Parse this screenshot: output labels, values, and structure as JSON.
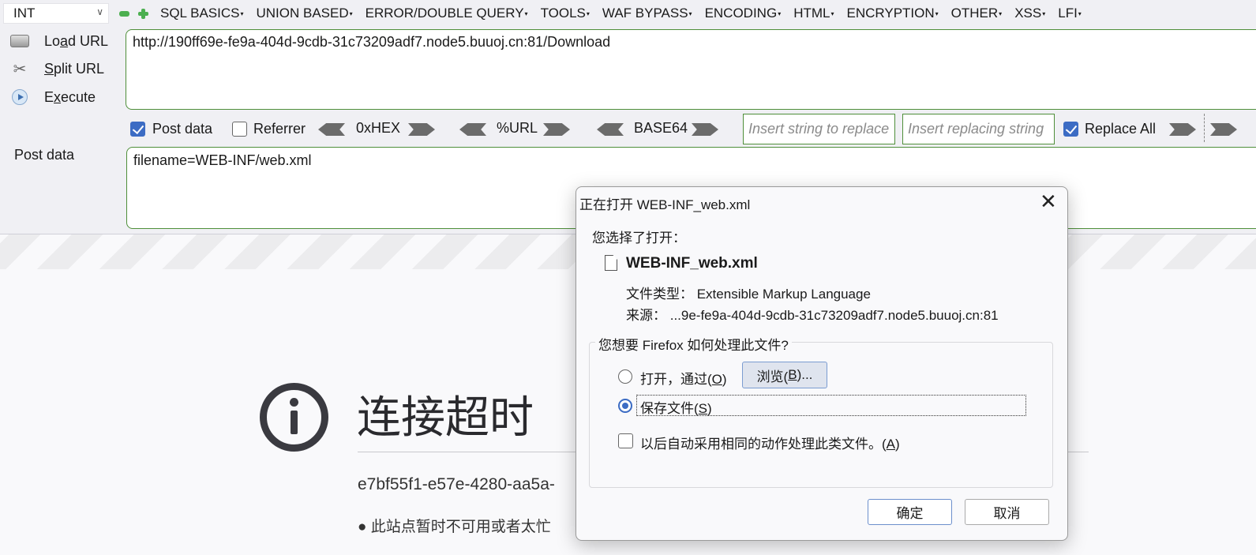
{
  "hackbar": {
    "type_select": "INT",
    "menu": [
      "SQL BASICS",
      "UNION BASED",
      "ERROR/DOUBLE QUERY",
      "TOOLS",
      "WAF BYPASS",
      "ENCODING",
      "HTML",
      "ENCRYPTION",
      "OTHER",
      "XSS",
      "LFI"
    ],
    "load_url": {
      "pre": "Lo",
      "key": "a",
      "post": "d URL"
    },
    "split_url": {
      "pre": "",
      "key": "S",
      "post": "plit URL"
    },
    "execute": {
      "pre": "E",
      "key": "x",
      "post": "ecute"
    },
    "url": "http://190ff69e-fe9a-404d-9cdb-31c73209adf7.node5.buuoj.cn:81/Download",
    "post_data_checkbox": "Post data",
    "post_data_checked": true,
    "referrer_checkbox": "Referrer",
    "referrer_checked": false,
    "hex_label": "0xHEX",
    "url_label": "%URL",
    "base64_label": "BASE64",
    "replace_placeholder": "Insert string to replace",
    "replacing_placeholder": "Insert replacing string",
    "replace_all_label": "Replace All",
    "replace_all_checked": true,
    "post_label": "Post data",
    "post_body": "filename=WEB-INF/web.xml"
  },
  "error_page": {
    "title": "连接超时",
    "id_text": "e7bf55f1-e57e-4280-aa5a-",
    "bullet": "此站点暂时不可用或者太忙"
  },
  "dialog": {
    "title": "正在打开 WEB-INF_web.xml",
    "chose_label": "您选择了打开：",
    "file_name": "WEB-INF_web.xml",
    "file_type": "文件类型：  Extensible Markup Language",
    "source": "来源：  ...9e-fe9a-404d-9cdb-31c73209adf7.node5.buuoj.cn:81",
    "question": "您想要 Firefox 如何处理此文件?",
    "open_with": {
      "pre": "打开，通过(",
      "key": "O",
      "post": ")"
    },
    "browse": {
      "pre": "浏览(",
      "key": "B",
      "post": ")..."
    },
    "save_file": {
      "pre": "保存文件(",
      "key": "S",
      "post": ")"
    },
    "selected_option": "save_file",
    "auto_action": {
      "pre": "以后自动采用相同的动作处理此类文件。(",
      "key": "A",
      "post": ")"
    },
    "auto_action_checked": false,
    "ok": "确定",
    "cancel": "取消"
  },
  "colors": {
    "accent": "#3c6cc4",
    "input_border": "#4f8f3a"
  }
}
